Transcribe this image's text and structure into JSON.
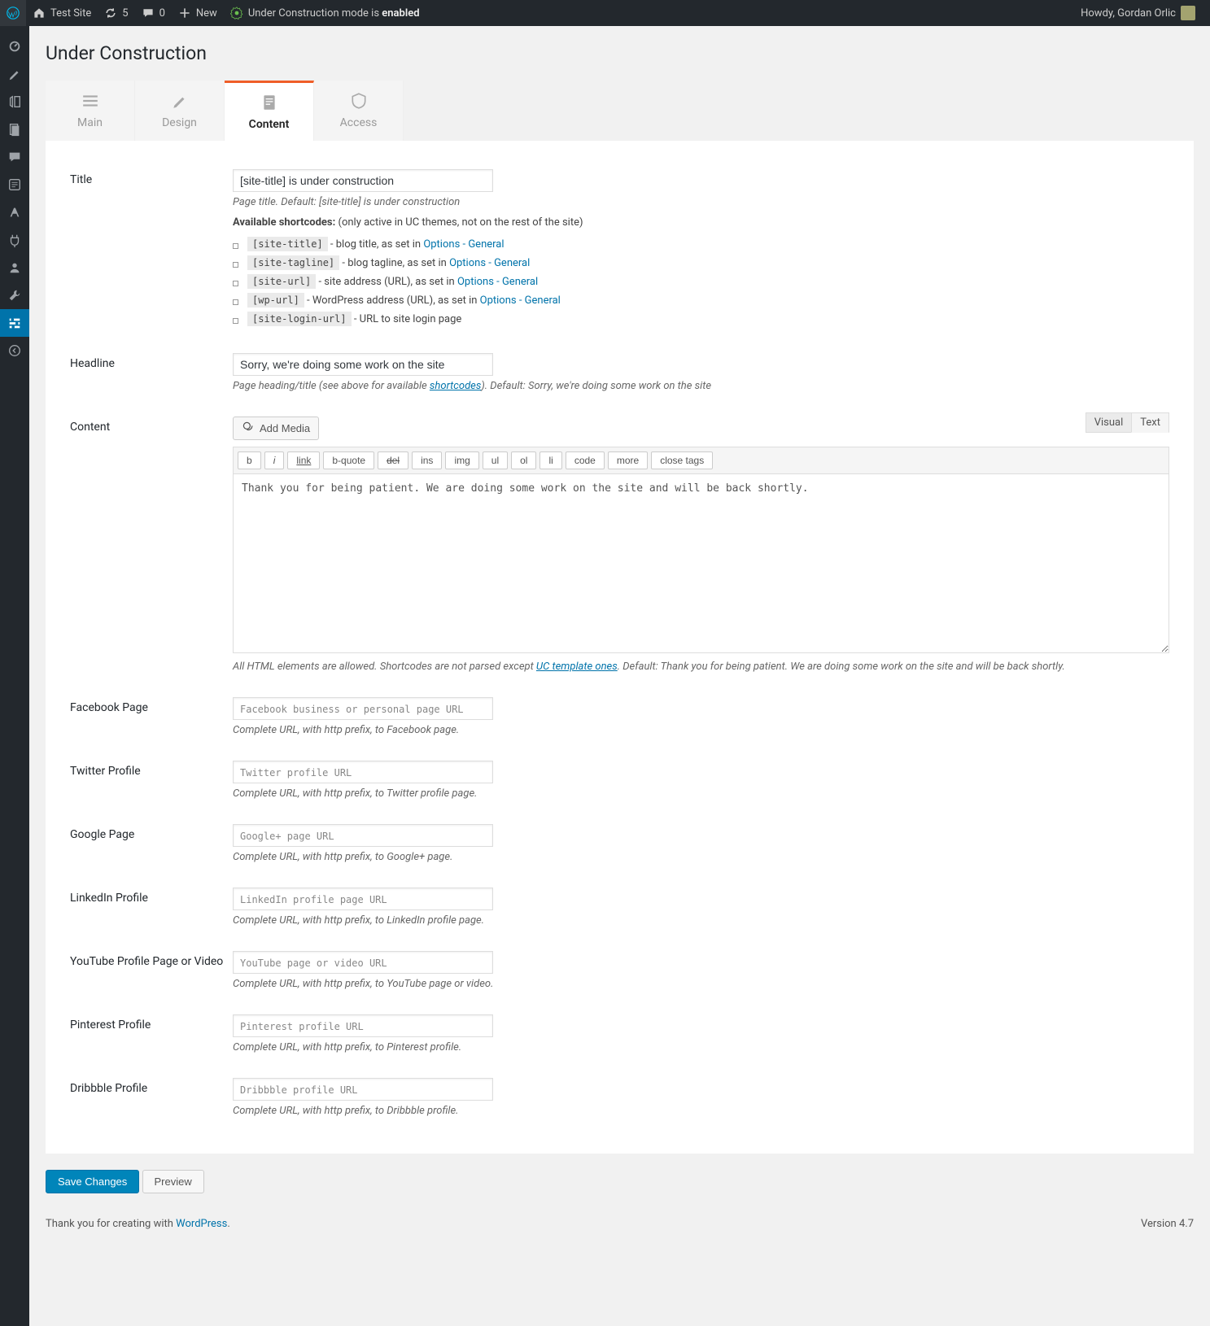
{
  "adminbar": {
    "site": "Test Site",
    "updates": "5",
    "comments": "0",
    "new": "New",
    "uc_prefix": "Under Construction mode is ",
    "uc_state": "enabled",
    "howdy": "Howdy, Gordan Orlic"
  },
  "page_title": "Under Construction",
  "tabs": {
    "main": "Main",
    "design": "Design",
    "content": "Content",
    "access": "Access"
  },
  "title_field": {
    "label": "Title",
    "value": "[site-title] is under construction",
    "desc": "Page title. Default: [site-title] is under construction",
    "avail_pref": "Available shortcodes:",
    "avail_suf": " (only active in UC themes, not on the rest of the site)"
  },
  "shortcodes": [
    {
      "code": "[site-title]",
      "text": " - blog title, as set in ",
      "link": "Options - General"
    },
    {
      "code": "[site-tagline]",
      "text": " - blog tagline, as set in ",
      "link": "Options - General"
    },
    {
      "code": "[site-url]",
      "text": " - site address (URL), as set in ",
      "link": "Options - General"
    },
    {
      "code": "[wp-url]",
      "text": " - WordPress address (URL), as set in ",
      "link": "Options - General"
    },
    {
      "code": "[site-login-url]",
      "text": " - URL to site login page",
      "link": ""
    }
  ],
  "headline": {
    "label": "Headline",
    "value": "Sorry, we're doing some work on the site",
    "desc_pre": "Page heading/title (see above for available ",
    "desc_link": "shortcodes",
    "desc_post": "). Default: Sorry, we're doing some work on the site"
  },
  "content_field": {
    "label": "Content",
    "add_media": "Add Media",
    "modes": {
      "visual": "Visual",
      "text": "Text"
    },
    "buttons": [
      "b",
      "i",
      "link",
      "b-quote",
      "del",
      "ins",
      "img",
      "ul",
      "ol",
      "li",
      "code",
      "more",
      "close tags"
    ],
    "text": "Thank you for being patient. We are doing some work on the site and will be back shortly.",
    "desc_pre": "All HTML elements are allowed. Shortcodes are not parsed except ",
    "desc_link": "UC template ones",
    "desc_post": ". Default: Thank you for being patient. We are doing some work on the site and will be back shortly."
  },
  "socials": [
    {
      "label": "Facebook Page",
      "ph": "Facebook business or personal page URL",
      "desc": "Complete URL, with http prefix, to Facebook page."
    },
    {
      "label": "Twitter Profile",
      "ph": "Twitter profile URL",
      "desc": "Complete URL, with http prefix, to Twitter profile page."
    },
    {
      "label": "Google Page",
      "ph": "Google+ page URL",
      "desc": "Complete URL, with http prefix, to Google+ page."
    },
    {
      "label": "LinkedIn Profile",
      "ph": "LinkedIn profile page URL",
      "desc": "Complete URL, with http prefix, to LinkedIn profile page."
    },
    {
      "label": "YouTube Profile Page or Video",
      "ph": "YouTube page or video URL",
      "desc": "Complete URL, with http prefix, to YouTube page or video."
    },
    {
      "label": "Pinterest Profile",
      "ph": "Pinterest profile URL",
      "desc": "Complete URL, with http prefix, to Pinterest profile."
    },
    {
      "label": "Dribbble Profile",
      "ph": "Dribbble profile URL",
      "desc": "Complete URL, with http prefix, to Dribbble profile."
    }
  ],
  "buttons": {
    "save": "Save Changes",
    "preview": "Preview"
  },
  "footer": {
    "pre": "Thank you for creating with ",
    "link": "WordPress",
    "post": ".",
    "version": "Version 4.7"
  }
}
